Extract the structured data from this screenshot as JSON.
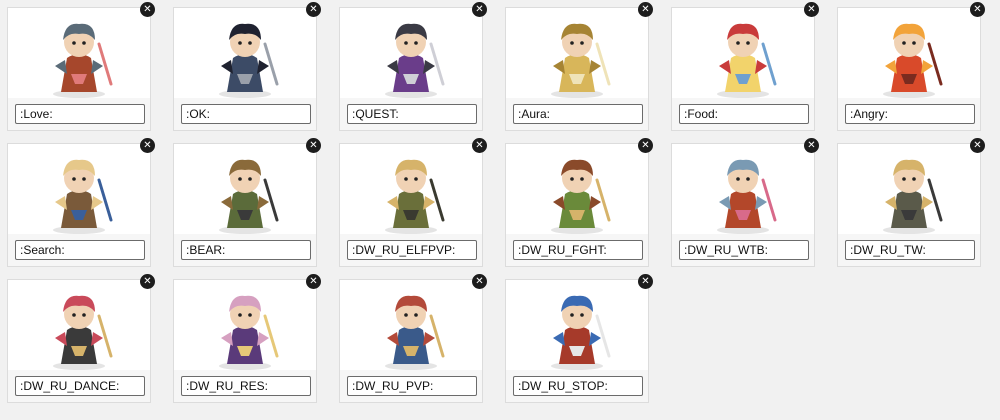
{
  "close_glyph": "✕",
  "emojis": [
    {
      "code": ":Love:",
      "icon": "chibi-warrior-with-wolf-love-icon",
      "colors": [
        "#a6472c",
        "#5a6b78",
        "#e07a7a"
      ]
    },
    {
      "code": ":OK:",
      "icon": "chibi-dark-elf-ok-icon",
      "colors": [
        "#3c4b66",
        "#1f2230",
        "#9aa0aa"
      ]
    },
    {
      "code": ":QUEST:",
      "icon": "chibi-purple-hair-elf-quest-icon",
      "colors": [
        "#6a3d8a",
        "#3a3a44",
        "#cfcfd6"
      ]
    },
    {
      "code": ":Aura:",
      "icon": "chibi-golden-paladin-aura-icon",
      "colors": [
        "#d8b65a",
        "#a68434",
        "#efe3b8"
      ]
    },
    {
      "code": ":Food:",
      "icon": "chibi-blonde-elf-food-icon",
      "colors": [
        "#f2d36b",
        "#c93b3b",
        "#6fa0cf"
      ]
    },
    {
      "code": ":Angry:",
      "icon": "chibi-fire-mage-angry-icon",
      "colors": [
        "#d94a2a",
        "#f2a33a",
        "#7a2b1f"
      ]
    },
    {
      "code": ":Search:",
      "icon": "chibi-explorer-search-icon",
      "colors": [
        "#7a5a3a",
        "#e6c88a",
        "#3a5f9a"
      ]
    },
    {
      "code": ":BEAR:",
      "icon": "orc-warrior-with-bear-icon",
      "colors": [
        "#5b6b3a",
        "#8a6a3a",
        "#3a3a3a"
      ]
    },
    {
      "code": ":DW_RU_ELFPVP:",
      "icon": "elf-pvp-banner-sticker-icon",
      "colors": [
        "#6a6f3a",
        "#d6b36a",
        "#3a3a30"
      ]
    },
    {
      "code": ":DW_RU_FGHT:",
      "icon": "orc-vs-human-fight-sticker-icon",
      "colors": [
        "#6a8a3a",
        "#8a4a2a",
        "#d6b36a"
      ]
    },
    {
      "code": ":DW_RU_WTB:",
      "icon": "redhead-girl-wtb-sticker-icon",
      "colors": [
        "#b3472a",
        "#7a9ab3",
        "#d86a8a"
      ]
    },
    {
      "code": ":DW_RU_TW:",
      "icon": "dwarf-golem-tw-sticker-icon",
      "colors": [
        "#5a5a4a",
        "#d6b36a",
        "#3a3a3a"
      ]
    },
    {
      "code": ":DW_RU_DANCE:",
      "icon": "undead-dancer-sticker-icon",
      "colors": [
        "#3a3a3a",
        "#c94a5a",
        "#d6b36a"
      ]
    },
    {
      "code": ":DW_RU_RES:",
      "icon": "priestess-res-sticker-icon",
      "colors": [
        "#5a3a7a",
        "#d6a0c0",
        "#e6c878"
      ]
    },
    {
      "code": ":DW_RU_PVP:",
      "icon": "troll-archer-pvp-sticker-icon",
      "colors": [
        "#3a5a8a",
        "#b34a3a",
        "#d6b36a"
      ]
    },
    {
      "code": ":DW_RU_STOP:",
      "icon": "stop-sign-girl-sticker-icon",
      "colors": [
        "#a63a2a",
        "#3a6ab3",
        "#e6e6e6"
      ]
    }
  ]
}
